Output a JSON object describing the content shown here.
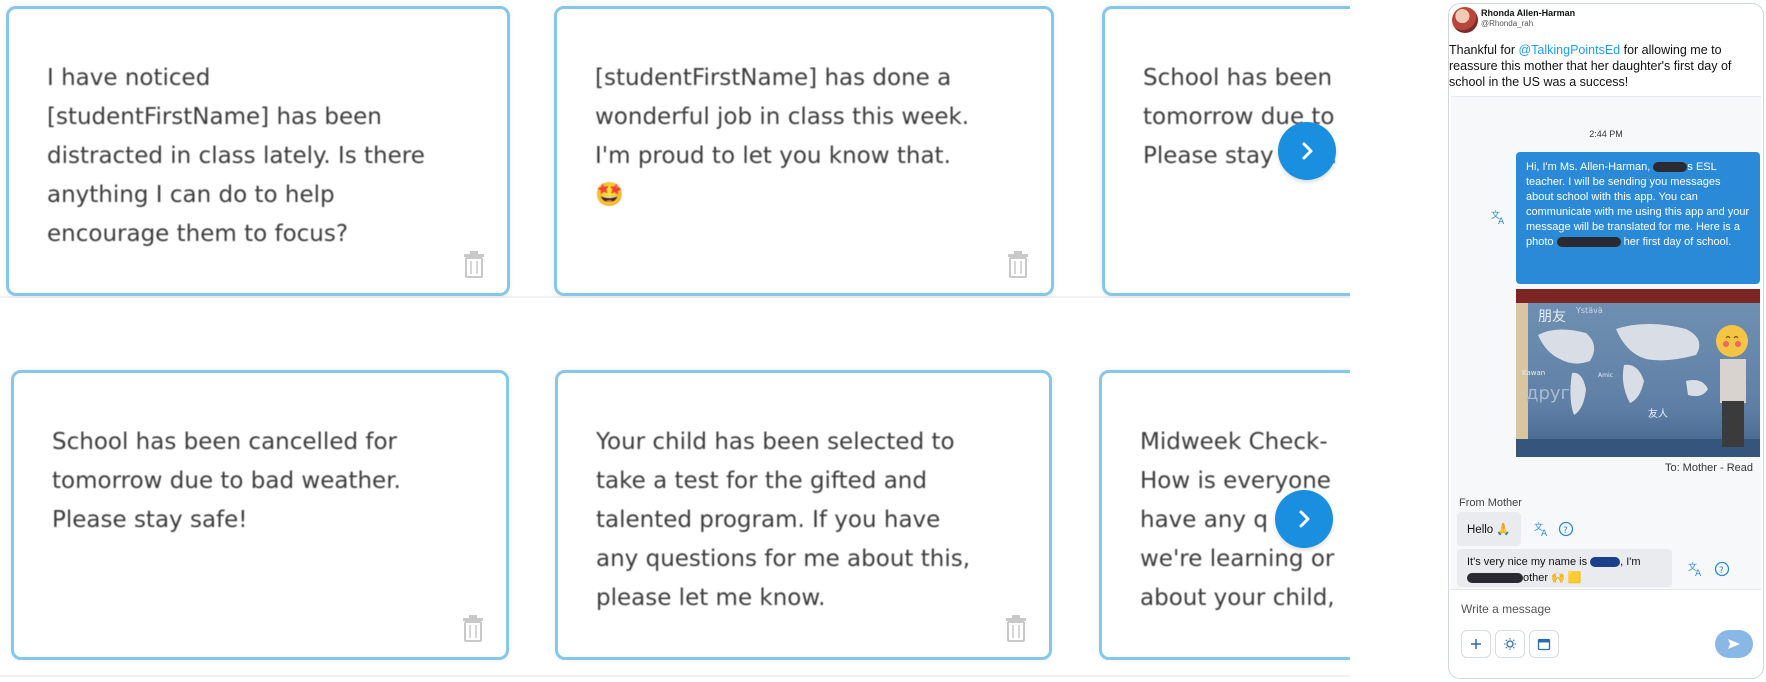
{
  "templates": {
    "row1": [
      {
        "text": "I have noticed\n[studentFirstName] has been\ndistracted in class lately. Is there\nanything I can do to help\nencourage them to focus?"
      },
      {
        "text": "[studentFirstName] has done a\nwonderful job in class this week.\nI'm proud to let you know that.\n🤩"
      },
      {
        "text": "School has been\ntomorrow due to\nPlease stay sa   !"
      }
    ],
    "row2": [
      {
        "text": "School has been cancelled for\ntomorrow due to bad weather.\nPlease stay safe!"
      },
      {
        "text": "Your child has been selected to\ntake a test for the gifted and\ntalented program. If you have\nany questions for me about this,\nplease let me know."
      },
      {
        "text": "Midweek Check-\nHow is everyone\nhave any q    o\nwe're learning or\nabout your child,"
      }
    ]
  },
  "tweet": {
    "name": "Rhonda Allen-Harman",
    "handle": "@Rhonda_rah",
    "body_before": "Thankful for ",
    "mention": "@TalkingPointsEd",
    "body_after": " for allowing me to reassure this mother that her daughter's first day of school in the US was a success!"
  },
  "chat": {
    "time": "2:44 PM",
    "outgoing_part1": "Hi, I'm Ms. Allen-Harman, ",
    "outgoing_part2": "s ESL teacher. I will be sending you messages about school with this app. You can communicate with me using this app and your message will be translated for me. Here is a photo ",
    "outgoing_part3": " her first day of school.",
    "photo_labels": {
      "friend_zh": "朋友",
      "friend_ru": "друг",
      "friend_zh2": "友人",
      "friends_fi": "Ystävä",
      "kawan": "Kawan",
      "amic": "Amic"
    },
    "to_read": "To: Mother - Read",
    "from_label": "From Mother",
    "incoming1": "Hello 🙏",
    "incoming2_part1": "It's very nice my name is ",
    "incoming2_part2": ", I'm",
    "incoming2_part3": "other 🙌 🟨",
    "compose_placeholder": "Write a message"
  },
  "colors": {
    "card_border": "#86c6ea",
    "accent": "#1a8fe0",
    "bubble": "#2b8ad8"
  }
}
